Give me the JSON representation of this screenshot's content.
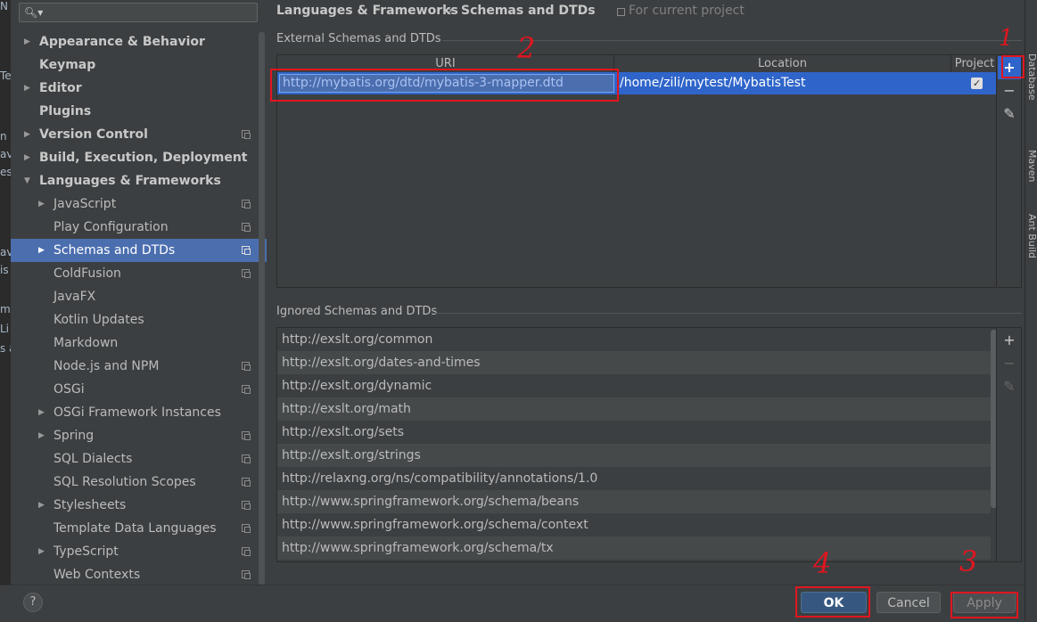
{
  "sidebar": {
    "search_placeholder": "",
    "items": [
      {
        "label": "Appearance & Behavior",
        "bold": true,
        "arrow": "right",
        "level": 0,
        "proj": false
      },
      {
        "label": "Keymap",
        "bold": true,
        "arrow": "",
        "level": 0,
        "proj": false
      },
      {
        "label": "Editor",
        "bold": true,
        "arrow": "right",
        "level": 0,
        "proj": false
      },
      {
        "label": "Plugins",
        "bold": true,
        "arrow": "",
        "level": 0,
        "proj": false
      },
      {
        "label": "Version Control",
        "bold": true,
        "arrow": "right",
        "level": 0,
        "proj": true
      },
      {
        "label": "Build, Execution, Deployment",
        "bold": true,
        "arrow": "right",
        "level": 0,
        "proj": false
      },
      {
        "label": "Languages & Frameworks",
        "bold": true,
        "arrow": "down",
        "level": 0,
        "proj": false
      },
      {
        "label": "JavaScript",
        "bold": false,
        "arrow": "right",
        "level": 1,
        "proj": true
      },
      {
        "label": "Play Configuration",
        "bold": false,
        "arrow": "",
        "level": 1,
        "proj": true
      },
      {
        "label": "Schemas and DTDs",
        "bold": false,
        "arrow": "right",
        "level": 1,
        "proj": true,
        "selected": true
      },
      {
        "label": "ColdFusion",
        "bold": false,
        "arrow": "",
        "level": 1,
        "proj": true
      },
      {
        "label": "JavaFX",
        "bold": false,
        "arrow": "",
        "level": 1,
        "proj": false
      },
      {
        "label": "Kotlin Updates",
        "bold": false,
        "arrow": "",
        "level": 1,
        "proj": false
      },
      {
        "label": "Markdown",
        "bold": false,
        "arrow": "",
        "level": 1,
        "proj": false
      },
      {
        "label": "Node.js and NPM",
        "bold": false,
        "arrow": "",
        "level": 1,
        "proj": true
      },
      {
        "label": "OSGi",
        "bold": false,
        "arrow": "",
        "level": 1,
        "proj": true
      },
      {
        "label": "OSGi Framework Instances",
        "bold": false,
        "arrow": "right",
        "level": 1,
        "proj": false
      },
      {
        "label": "Spring",
        "bold": false,
        "arrow": "right",
        "level": 1,
        "proj": true
      },
      {
        "label": "SQL Dialects",
        "bold": false,
        "arrow": "",
        "level": 1,
        "proj": true
      },
      {
        "label": "SQL Resolution Scopes",
        "bold": false,
        "arrow": "",
        "level": 1,
        "proj": true
      },
      {
        "label": "Stylesheets",
        "bold": false,
        "arrow": "right",
        "level": 1,
        "proj": true
      },
      {
        "label": "Template Data Languages",
        "bold": false,
        "arrow": "",
        "level": 1,
        "proj": true
      },
      {
        "label": "TypeScript",
        "bold": false,
        "arrow": "right",
        "level": 1,
        "proj": true
      },
      {
        "label": "Web Contexts",
        "bold": false,
        "arrow": "",
        "level": 1,
        "proj": true
      }
    ]
  },
  "header": {
    "breadcrumb_parent": "Languages & Frameworks",
    "breadcrumb_sep": "›",
    "breadcrumb_current": "Schemas and DTDs",
    "scope_note": "For current project"
  },
  "external": {
    "section_title": "External Schemas and DTDs",
    "columns": {
      "uri": "URI",
      "location": "Location",
      "project": "Project"
    },
    "rows": [
      {
        "uri": "http://mybatis.org/dtd/mybatis-3-mapper.dtd",
        "location": "/home/zili/mytest/MybatisTest",
        "project": true
      }
    ],
    "tools": {
      "add": "+",
      "remove": "−",
      "edit": "✎"
    }
  },
  "ignored": {
    "section_title": "Ignored Schemas and DTDs",
    "rows": [
      "http://exslt.org/common",
      "http://exslt.org/dates-and-times",
      "http://exslt.org/dynamic",
      "http://exslt.org/math",
      "http://exslt.org/sets",
      "http://exslt.org/strings",
      "http://relaxng.org/ns/compatibility/annotations/1.0",
      "http://www.springframework.org/schema/beans",
      "http://www.springframework.org/schema/context",
      "http://www.springframework.org/schema/tx"
    ],
    "tools": {
      "add": "+",
      "remove": "−",
      "edit": "✎"
    }
  },
  "buttons": {
    "help": "?",
    "ok": "OK",
    "cancel": "Cancel",
    "apply": "Apply"
  },
  "right_strip": {
    "tabs": [
      "Database",
      "Maven",
      "Ant Build"
    ]
  },
  "ide_strip": {
    "fragments": [
      "N",
      "Te",
      "n",
      "av",
      "es",
      "av",
      "is",
      "m",
      "Li",
      "s a"
    ]
  },
  "annotations": {
    "n1": "1",
    "n2": "2",
    "n3": "3",
    "n4": "4"
  },
  "colors": {
    "selection": "#4b6eaf",
    "row_selected": "#2f65ca",
    "annotation_red": "#e0161f",
    "ok_button": "#365880"
  }
}
